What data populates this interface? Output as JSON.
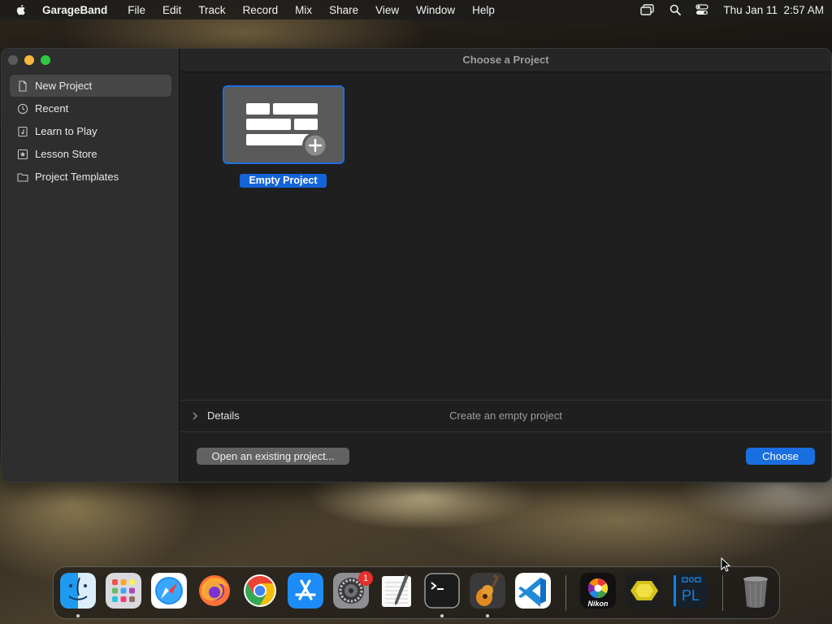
{
  "menubar": {
    "app_name": "GarageBand",
    "items": [
      "File",
      "Edit",
      "Track",
      "Record",
      "Mix",
      "Share",
      "View",
      "Window",
      "Help"
    ],
    "clock": "Thu Jan 11  2:57 AM"
  },
  "window": {
    "title": "Choose a Project",
    "sidebar": {
      "items": [
        {
          "label": "New Project",
          "icon": "document-icon",
          "selected": true
        },
        {
          "label": "Recent",
          "icon": "clock-icon",
          "selected": false
        },
        {
          "label": "Learn to Play",
          "icon": "music-book-icon",
          "selected": false
        },
        {
          "label": "Lesson Store",
          "icon": "star-box-icon",
          "selected": false
        },
        {
          "label": "Project Templates",
          "icon": "folder-icon",
          "selected": false
        }
      ]
    },
    "projects": [
      {
        "label": "Empty Project",
        "selected": true
      }
    ],
    "details": {
      "label": "Details",
      "description": "Create an empty project"
    },
    "buttons": {
      "open_existing": "Open an existing project...",
      "choose": "Choose"
    }
  },
  "dock": {
    "apps": [
      {
        "name": "Finder",
        "running": true
      },
      {
        "name": "Launchpad",
        "running": false
      },
      {
        "name": "Safari",
        "running": false
      },
      {
        "name": "Firefox",
        "running": false
      },
      {
        "name": "Chrome",
        "running": false
      },
      {
        "name": "App Store",
        "running": false
      },
      {
        "name": "System Settings",
        "running": false,
        "badge": "1"
      },
      {
        "name": "TextEdit",
        "running": false
      },
      {
        "name": "Terminal",
        "running": true
      },
      {
        "name": "GarageBand",
        "running": true
      },
      {
        "name": "Visual Studio Code",
        "running": false
      },
      {
        "name": "Nikon",
        "label": "Nikon",
        "running": false
      },
      {
        "name": "Hexagon app",
        "running": false
      },
      {
        "name": "PL app",
        "label": "PL",
        "running": false
      },
      {
        "name": "Trash",
        "running": false
      }
    ]
  },
  "colors": {
    "accent": "#1a6fe0",
    "sidebar_bg": "#2e2e2e",
    "main_bg": "#1f1f1f"
  }
}
